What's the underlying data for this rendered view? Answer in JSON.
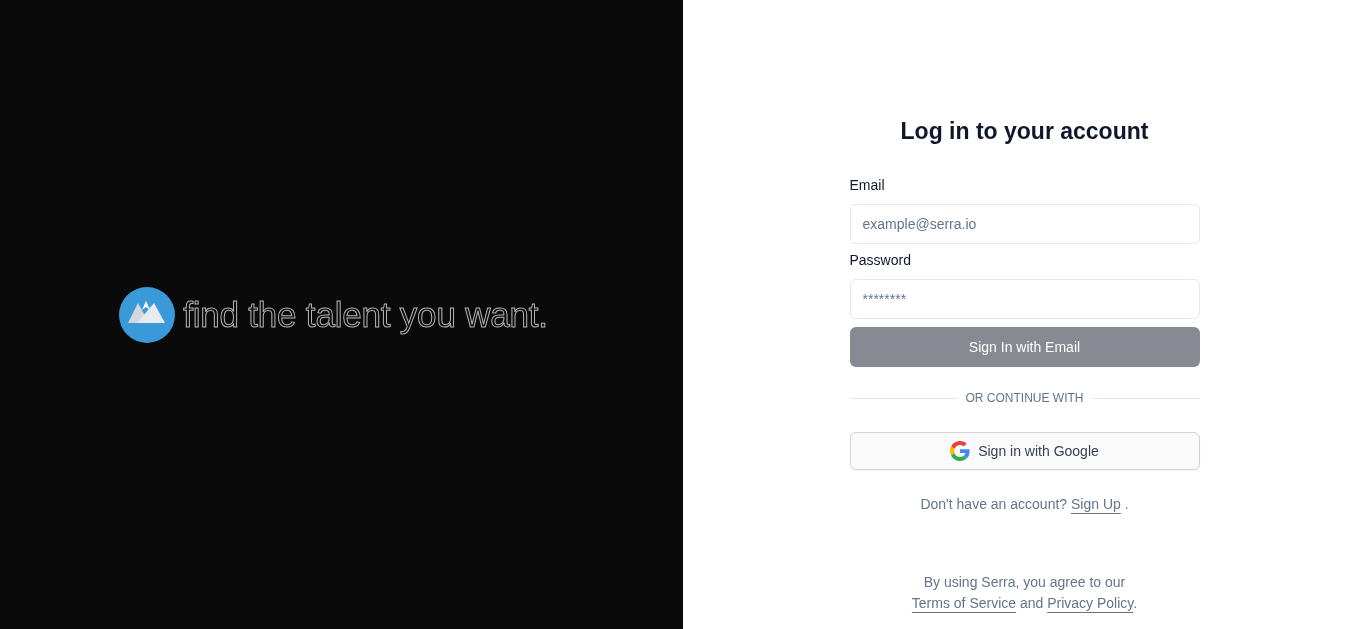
{
  "brand": {
    "tagline": "find the talent you want."
  },
  "login": {
    "title": "Log in to your account",
    "fields": [
      {
        "label": "Email",
        "placeholder": "example@serra.io"
      },
      {
        "label": "Password",
        "placeholder": "********"
      }
    ],
    "submit_button": {
      "label": "Sign In with Email",
      "disabled": true
    },
    "divider": "OR CONTINUE WITH",
    "google_button": {
      "label": "Sign in with Google"
    },
    "signup_prompt": {
      "parts": [
        {
          "kind": "text",
          "text": "Don't have an account? "
        },
        {
          "kind": "link",
          "text": "Sign Up"
        },
        {
          "kind": "text",
          "text": " ."
        }
      ]
    }
  },
  "legal_notice": {
    "parts": [
      {
        "kind": "text",
        "text": "By using Serra, you agree to our "
      },
      {
        "kind": "link",
        "text": "Terms of Service"
      },
      {
        "kind": "text",
        "text": " and "
      },
      {
        "kind": "link",
        "text": "Privacy Policy"
      },
      {
        "kind": "text",
        "text": "."
      }
    ]
  }
}
